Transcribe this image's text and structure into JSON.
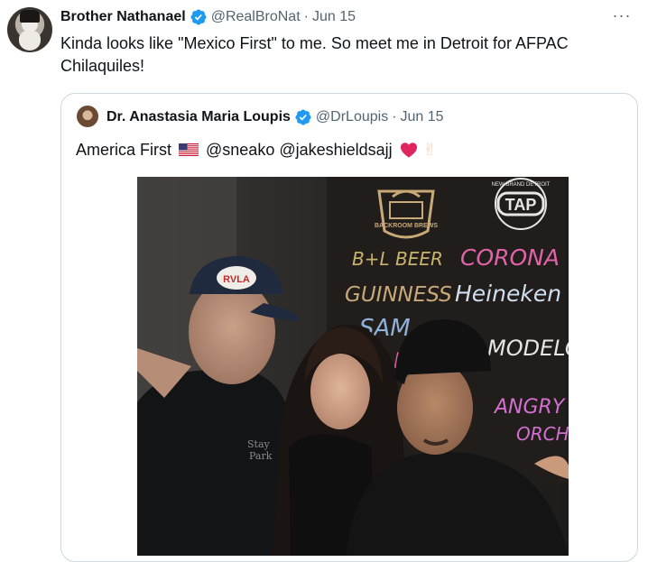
{
  "tweet": {
    "author_name": "Brother Nathanael",
    "handle": "@RealBroNat",
    "separator": "·",
    "date": "Jun 15",
    "more_label": "···",
    "text": "Kinda looks like \"Mexico First\" to me. So meet me in Detroit for AFPAC Chilaquiles!"
  },
  "quote": {
    "author_name": "Dr. Anastasia Maria Loupis",
    "handle": "@DrLoupis",
    "separator": "·",
    "date": "Jun 15",
    "text_prefix": "America First",
    "mentions": "@sneako @jakeshieldsajj",
    "peace_emoji": "✌"
  },
  "photo": {
    "chalkboard": {
      "logo_left_top": "BACKROOM BREWS",
      "logo_right": "TAP",
      "logo_right_ring": "NEW BRAND DETROIT",
      "line1_left": "B+L BEER",
      "line2_left": "GUINNESS",
      "line3_left": "SAM",
      "line4_left": "F",
      "line1_right": "CORONA",
      "line2_right": "Heineken",
      "line3_right": "MODELO",
      "line4_right": "ANGRY",
      "line5_right": "ORCHID"
    },
    "cap_text": "RVLA",
    "shirt_text_1": "Stay",
    "shirt_text_2": "Park"
  },
  "colors": {
    "verified_blue": "#1d9bf0",
    "text_primary": "#0f1419",
    "text_secondary": "#536471",
    "border": "#cfd9de",
    "heart_red": "#f91880"
  }
}
